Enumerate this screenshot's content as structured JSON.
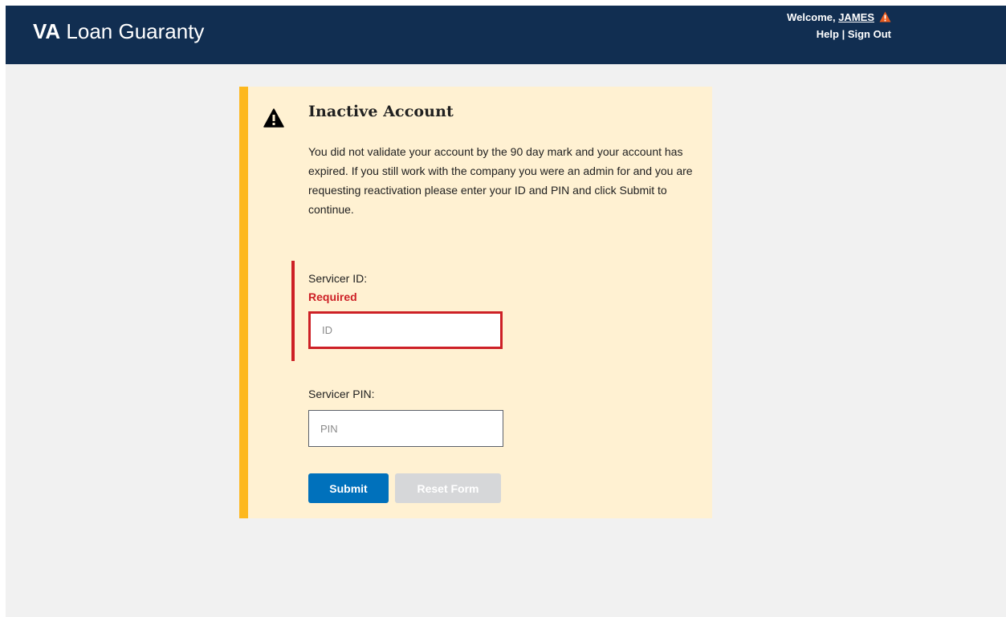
{
  "header": {
    "brand_strong": "VA",
    "brand_rest": " Loan Guaranty",
    "welcome_prefix": "Welcome, ",
    "username": "JAMES",
    "help_label": "Help",
    "separator": " | ",
    "sign_out_label": "Sign Out",
    "background_color": "#112e51"
  },
  "alert": {
    "icon": "warning-icon",
    "title": "Inactive Account",
    "body": "You did not validate your account by the 90 day mark and your account has expired. If you still work with the company you were an admin for and you are requesting reactivation please enter your ID and PIN and click Submit to continue.",
    "bar_color": "#fdb81e",
    "background_color": "#fff1d2"
  },
  "form": {
    "servicer_id": {
      "label": "Servicer ID:",
      "error": "Required",
      "placeholder": "ID",
      "value": ""
    },
    "servicer_pin": {
      "label": "Servicer PIN:",
      "placeholder": "PIN",
      "value": ""
    },
    "submit_label": "Submit",
    "reset_label": "Reset Form",
    "error_color": "#cd2026",
    "primary_color": "#0071bc"
  }
}
